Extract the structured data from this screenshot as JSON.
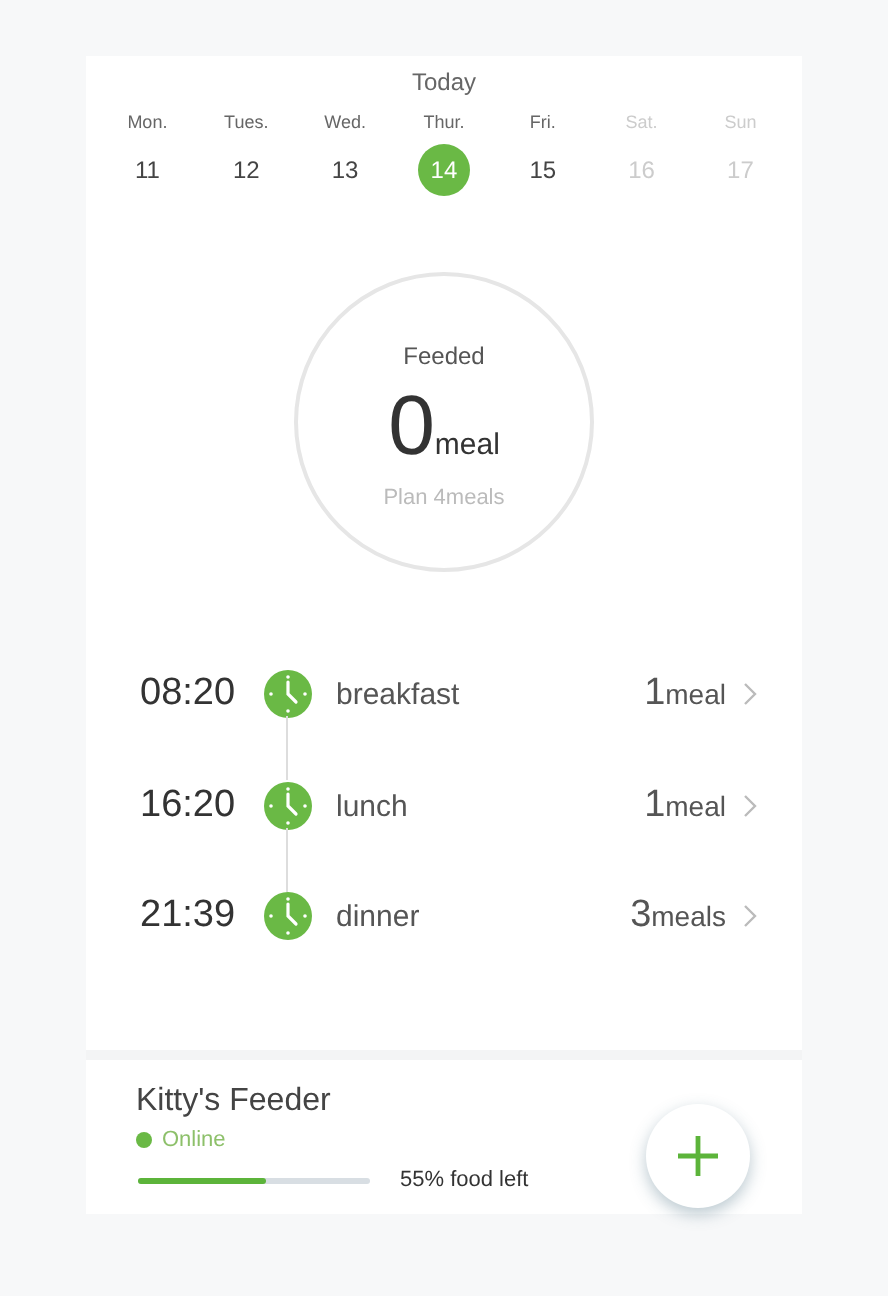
{
  "header": {
    "title": "Today"
  },
  "days": [
    {
      "weekday": "Mon.",
      "date": "11",
      "selected": false,
      "disabled": false
    },
    {
      "weekday": "Tues.",
      "date": "12",
      "selected": false,
      "disabled": false
    },
    {
      "weekday": "Wed.",
      "date": "13",
      "selected": false,
      "disabled": false
    },
    {
      "weekday": "Thur.",
      "date": "14",
      "selected": true,
      "disabled": false
    },
    {
      "weekday": "Fri.",
      "date": "15",
      "selected": false,
      "disabled": false
    },
    {
      "weekday": "Sat.",
      "date": "16",
      "selected": false,
      "disabled": true
    },
    {
      "weekday": "Sun",
      "date": "17",
      "selected": false,
      "disabled": true
    }
  ],
  "summary": {
    "label": "Feeded",
    "count": "0",
    "unit": "meal",
    "plan": "Plan 4meals"
  },
  "meals": [
    {
      "time": "08:20",
      "name": "breakfast",
      "count": "1",
      "unit": "meal"
    },
    {
      "time": "16:20",
      "name": "lunch",
      "count": "1",
      "unit": "meal"
    },
    {
      "time": "21:39",
      "name": "dinner",
      "count": "3",
      "unit": "meals"
    }
  ],
  "device": {
    "name": "Kitty's Feeder",
    "online": true,
    "status": "Online",
    "level": 0.55,
    "food_left": "55% food left"
  }
}
